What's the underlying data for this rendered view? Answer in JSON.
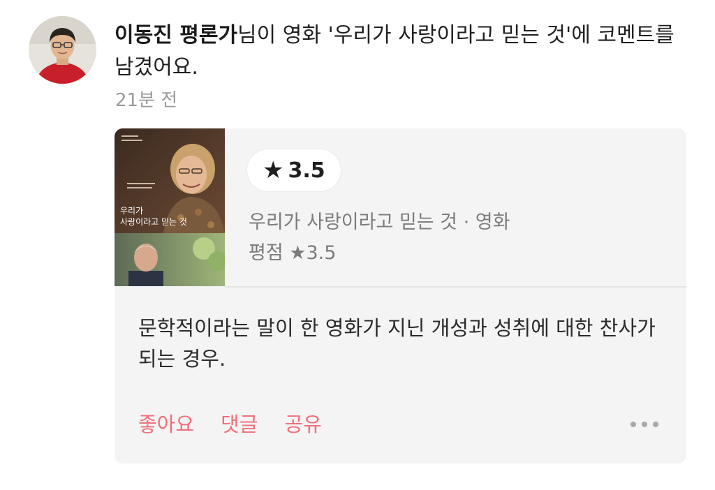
{
  "activity": {
    "user_name": "이동진 평론가",
    "message": "님이 영화 '우리가 사랑이라고 믿는 것'에 코멘트를 남겼어요.",
    "timestamp": "21분 전"
  },
  "card": {
    "poster": {
      "title_text": "우리가 사랑이라고 믿는 것",
      "icon": "movie-poster-image"
    },
    "user_rating": {
      "star_glyph": "★",
      "value": "3.5"
    },
    "movie_line": "우리가 사랑이라고 믿는 것 · 영화",
    "avg_rating_line": "평점 ★3.5",
    "comment": "문학적이라는 말이 한 영화가 지닌 개성과 성취에 대한 찬사가 되는 경우.",
    "actions": {
      "like": "좋아요",
      "reply": "댓글",
      "share": "공유"
    },
    "more_icon": "more-horizontal-icon"
  },
  "colors": {
    "action_accent": "#f0707a",
    "card_background": "#f4f4f5",
    "secondary_text": "#7b7b7b",
    "timestamp_text": "#9a9a9a"
  }
}
